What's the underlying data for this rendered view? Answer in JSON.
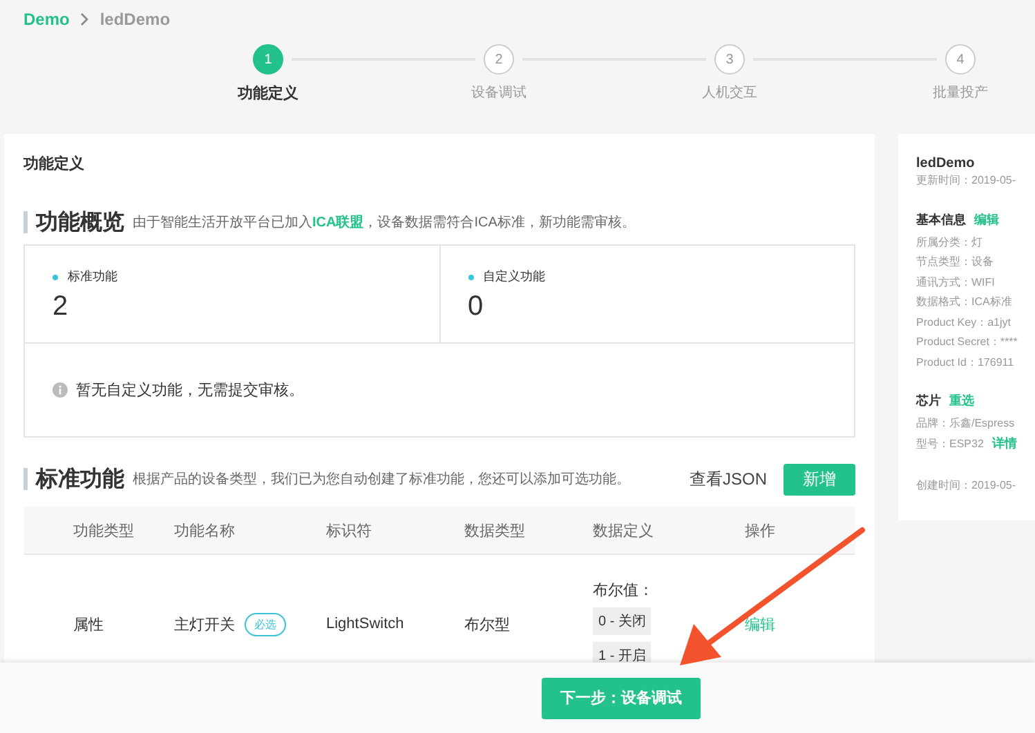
{
  "breadcrumb": [
    {
      "label": "Demo",
      "kind": "link"
    },
    {
      "label": "ledDemo",
      "kind": "current"
    }
  ],
  "steps": [
    {
      "number": "1",
      "label": "功能定义",
      "selected": true
    },
    {
      "number": "2",
      "label": "设备调试",
      "selected": false
    },
    {
      "number": "3",
      "label": "人机交互",
      "selected": false
    },
    {
      "number": "4",
      "label": "批量投产",
      "selected": false
    }
  ],
  "main": {
    "title": "功能定义",
    "overview": {
      "heading": "功能概览",
      "note_before": "由于智能生活开放平台已加入",
      "note_link": "ICA联盟",
      "note_after": "，设备数据需符合ICA标准，新功能需审核。",
      "stats": [
        {
          "label": "标准功能",
          "value": "2"
        },
        {
          "label": "自定义功能",
          "value": "0"
        }
      ],
      "message": "暂无自定义功能，无需提交审核。"
    },
    "standard": {
      "heading": "标准功能",
      "note": "根据产品的设备类型，我们已为您自动创建了标准功能，您还可以添加可选功能。",
      "actions": [
        {
          "label": "查看JSON",
          "kind": "link"
        },
        {
          "label": "新增",
          "kind": "primary"
        }
      ],
      "table": {
        "columns": [
          "功能类型",
          "功能名称",
          "标识符",
          "数据类型",
          "数据定义",
          "操作"
        ],
        "rows": [
          {
            "type": "属性",
            "name": "主灯开关",
            "tag": "必选",
            "identifier": "LightSwitch",
            "data_type": "布尔型",
            "definition": {
              "label": "布尔值：",
              "values": [
                "0 - 关闭",
                "1 - 开启"
              ]
            },
            "action": "编辑"
          }
        ]
      }
    }
  },
  "info": {
    "title": "ledDemo",
    "updated": {
      "label": "更新时间：",
      "value": "2019-05-"
    },
    "sections": [
      {
        "heading": "基本信息",
        "action": "编辑",
        "fields": [
          {
            "label": "所属分类：",
            "value": "灯"
          },
          {
            "label": "节点类型：",
            "value": "设备"
          },
          {
            "label": "通讯方式：",
            "value": "WIFI"
          },
          {
            "label": "数据格式：",
            "value": "ICA标准"
          },
          {
            "label": "Product Key：",
            "value": "a1jyt"
          },
          {
            "label": "Product Secret：",
            "value": "****"
          },
          {
            "label": "Product Id：",
            "value": "176911"
          }
        ]
      },
      {
        "heading": "芯片",
        "action": "重选",
        "fields": [
          {
            "label": "品牌：",
            "value": "乐鑫/Espress"
          },
          {
            "label": "型号：",
            "value": "ESP32",
            "link": "详情"
          }
        ]
      }
    ],
    "created": {
      "label": "创建时间：",
      "value": "2019-05-"
    }
  },
  "footer": {
    "button": "下一步：设备调试"
  }
}
